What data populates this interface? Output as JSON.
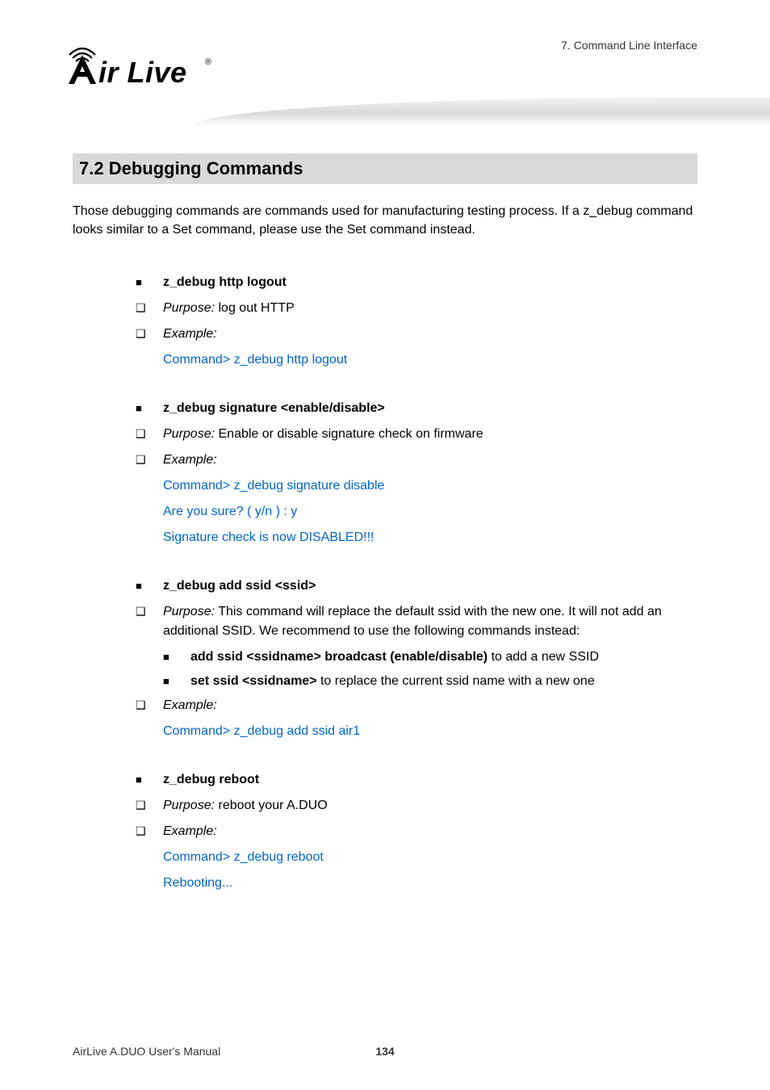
{
  "header": {
    "chapter": "7. Command Line Interface",
    "logo_text": "ir Live"
  },
  "section": {
    "number": "7.2",
    "title": "Debugging Commands"
  },
  "intro": "Those debugging commands are commands used for manufacturing testing process. If a z_debug command looks similar to a Set command, please use the Set command instead.",
  "blocks": [
    {
      "cmd": "z_debug http logout",
      "purpose_label": "Purpose:",
      "purpose_text": "   log out HTTP",
      "example_label": "Example:",
      "outputs": [
        "Command> z_debug http logout"
      ]
    },
    {
      "cmd": "z_debug signature <enable/disable>",
      "purpose_label": "Purpose:",
      "purpose_text": " Enable or disable signature check on firmware",
      "example_label": "Example:",
      "outputs": [
        "Command> z_debug signature disable",
        "Are you sure? ( y/n ) : y",
        "Signature check is now DISABLED!!!"
      ]
    },
    {
      "cmd": "z_debug add ssid <ssid>",
      "purpose_label": "Purpose:",
      "purpose_text": "   This command will replace the default ssid with the new one.   It will not add an additional SSID.   We recommend to use the following commands instead:",
      "subitems": [
        {
          "bold": "add ssid <ssidname> broadcast (enable/disable)",
          "rest": " to add a new SSID"
        },
        {
          "bold": "set ssid <ssidname>",
          "rest": " to replace the current ssid name with a new one"
        }
      ],
      "example_label": "Example:",
      "outputs": [
        "Command> z_debug add ssid air1"
      ]
    },
    {
      "cmd": "z_debug reboot",
      "purpose_label": "Purpose:",
      "purpose_text": "   reboot your A.DUO",
      "example_label": "Example:",
      "outputs": [
        "Command> z_debug reboot",
        "Rebooting..."
      ]
    }
  ],
  "footer": {
    "left": "AirLive A.DUO User's Manual",
    "page": "134"
  }
}
